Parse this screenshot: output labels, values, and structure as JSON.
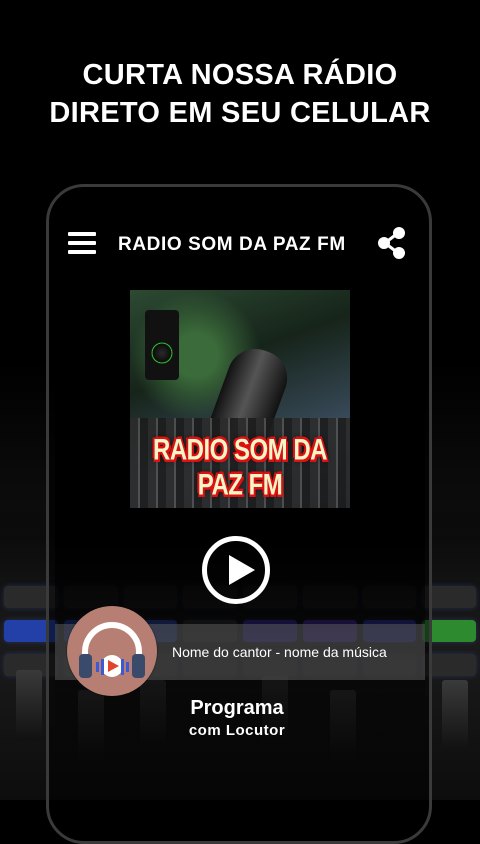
{
  "headline": {
    "line1": "CURTA NOSSA RÁDIO",
    "line2": "DIRETO EM SEU CELULAR"
  },
  "app": {
    "title": "RADIO SOM DA PAZ FM",
    "menu_icon": "hamburger-menu-icon",
    "share_icon": "share-icon"
  },
  "cover": {
    "text": "RADIO SOM DA PAZ FM"
  },
  "player": {
    "play_icon": "play-icon",
    "now_playing": "Nome do cantor - nome da música",
    "program_title": "Programa",
    "program_subtitle": "com Locutor",
    "logo_icon": "headphones-icon"
  },
  "colors": {
    "background": "#000000",
    "text": "#ffffff",
    "logo_bg": "#b77f73",
    "logo_accent": "#e0452b"
  }
}
